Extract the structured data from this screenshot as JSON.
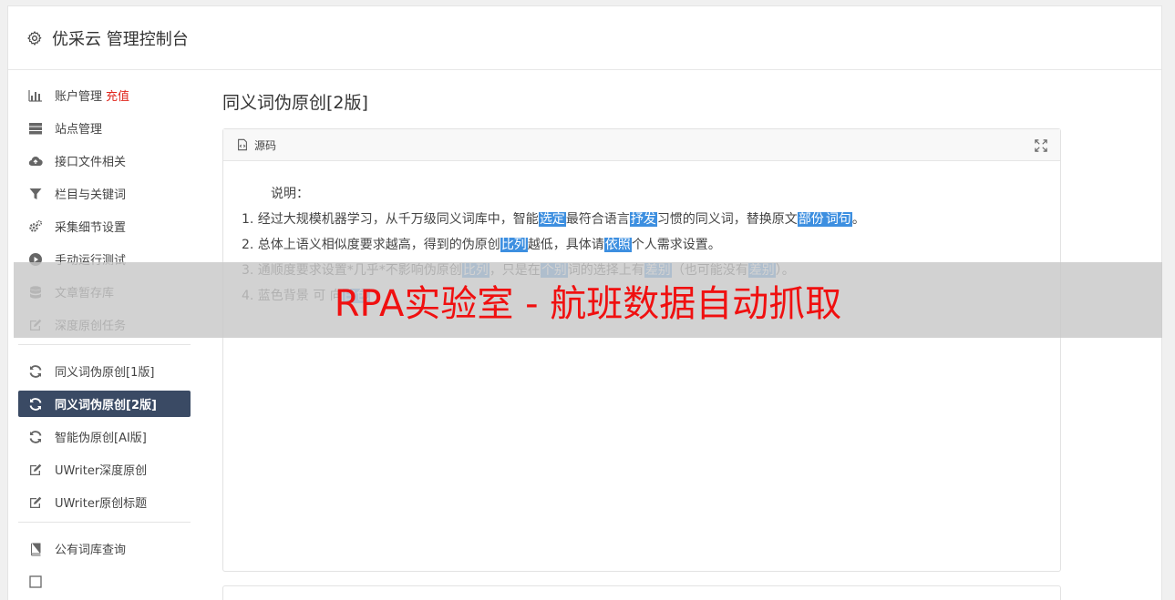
{
  "header": {
    "title": "优采云 管理控制台",
    "icon": "gear-icon"
  },
  "sidebar": {
    "groups": [
      [
        {
          "label": "账户管理",
          "badge": "充值",
          "icon": "bar-chart-icon"
        },
        {
          "label": "站点管理",
          "icon": "server-icon"
        },
        {
          "label": "接口文件相关",
          "icon": "cloud-upload-icon"
        },
        {
          "label": "栏目与关键词",
          "icon": "filter-icon"
        },
        {
          "label": "采集细节设置",
          "icon": "gears-icon"
        },
        {
          "label": "手动运行测试",
          "icon": "play-circle-icon"
        },
        {
          "label": "文章暂存库",
          "icon": "database-icon"
        },
        {
          "label": "深度原创任务",
          "icon": "edit-icon"
        }
      ],
      [
        {
          "label": "同义词伪原创[1版]",
          "icon": "refresh-icon"
        },
        {
          "label": "同义词伪原创[2版]",
          "icon": "refresh-icon",
          "active": true
        },
        {
          "label": "智能伪原创[AI版]",
          "icon": "refresh-icon"
        },
        {
          "label": "UWriter深度原创",
          "icon": "edit-icon"
        },
        {
          "label": "UWriter原创标题",
          "icon": "edit-icon"
        }
      ],
      [
        {
          "label": "公有词库查询",
          "icon": "book-icon"
        },
        {
          "label": "",
          "icon": "square-icon"
        }
      ]
    ]
  },
  "main": {
    "title": "同义词伪原创[2版]",
    "panel": {
      "header_label": "源码",
      "intro": "说明：",
      "lines": [
        [
          {
            "t": "1. 经过大规模机器学习，从千万级同义词库中，智能"
          },
          {
            "t": "选定",
            "hl": true
          },
          {
            "t": "最符合语言"
          },
          {
            "t": "抒发",
            "hl": true
          },
          {
            "t": "习惯的同义词，替换原文"
          },
          {
            "t": "部份",
            "hl": true
          },
          {
            "t": ""
          },
          {
            "t": "词句",
            "hl": true
          },
          {
            "t": "。"
          }
        ],
        [
          {
            "t": "2. 总体上语义相似度要求越高，得到的伪原创"
          },
          {
            "t": "比列",
            "hl": true
          },
          {
            "t": "越低，具体请"
          },
          {
            "t": "依照",
            "hl": true
          },
          {
            "t": "个人需求设置。"
          }
        ],
        [
          {
            "t": "3. 通顺度要求设置*几乎*不影响伪原创"
          },
          {
            "t": "比列",
            "hl": true
          },
          {
            "t": "，只是在"
          },
          {
            "t": "个别",
            "hl": true
          },
          {
            "t": "词的选择上有"
          },
          {
            "t": "差别",
            "hl": true
          },
          {
            "t": "（也可能没有"
          },
          {
            "t": "差别",
            "hl": true
          },
          {
            "t": "）。"
          }
        ],
        [
          {
            "t": "4. 蓝色背景"
          },
          {
            "t": "      "
          },
          {
            "t": "可"
          },
          {
            "t": "   "
          },
          {
            "t": "向"
          },
          {
            "t": "白色",
            "hl": true
          }
        ]
      ]
    }
  },
  "overlay": {
    "text": "RPA实验室 - 航班数据自动抓取"
  }
}
